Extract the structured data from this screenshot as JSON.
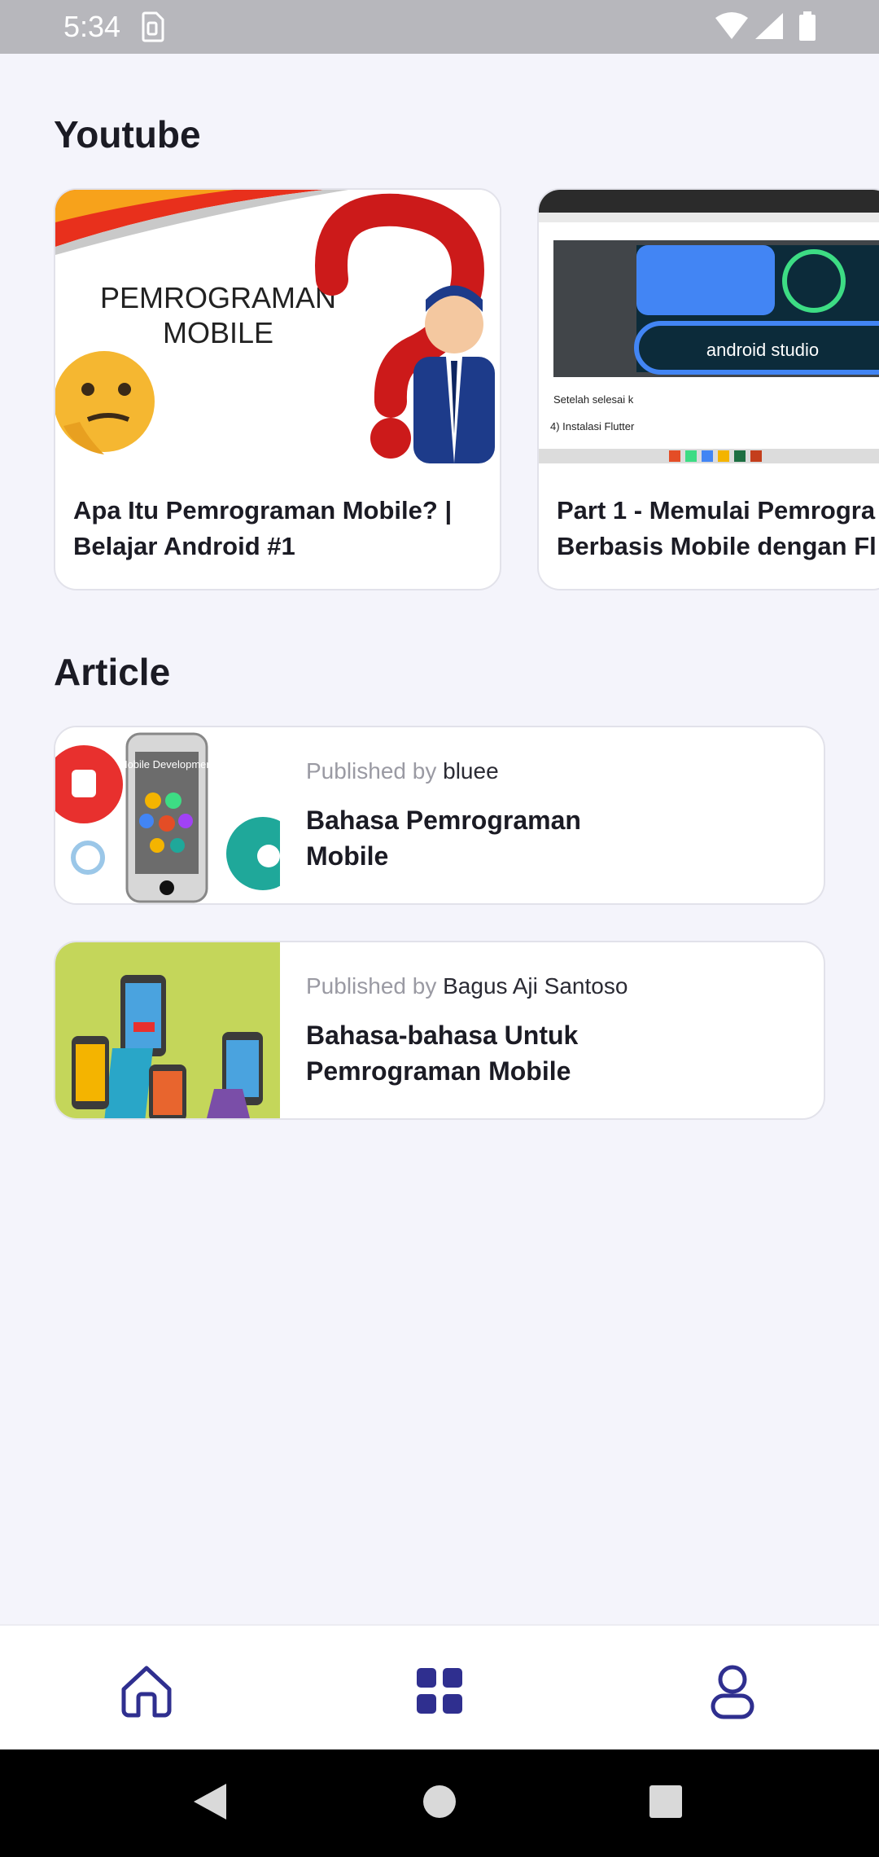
{
  "status_bar": {
    "time": "5:34"
  },
  "sections": {
    "youtube_title": "Youtube",
    "article_title": "Article"
  },
  "youtube": [
    {
      "title": "Apa Itu Pemrograman Mobile? | Belajar Android #1",
      "thumb_text_line1": "PEMROGRAMAN",
      "thumb_text_line2": "MOBILE"
    },
    {
      "title": "Part 1 - Memulai Pemrogra\nBerbasis Mobile dengan Fl",
      "thumb_text_brand": "android studio",
      "thumb_text_caption1": "Setelah selesai k",
      "thumb_text_caption2": "4)  Instalasi Flutter"
    }
  ],
  "articles": [
    {
      "published_by_label": "Published by",
      "author": "bluee",
      "title": "Bahasa Pemrograman Mobile",
      "thumb_text": "Mobile Development"
    },
    {
      "published_by_label": "Published by",
      "author": "Bagus Aji Santoso",
      "title": "Bahasa-bahasa Untuk Pemrograman Mobile"
    }
  ],
  "colors": {
    "accent": "#2f2f8f",
    "background": "#f4f4fb"
  },
  "bottom_nav": [
    {
      "icon": "home-icon"
    },
    {
      "icon": "grid-icon"
    },
    {
      "icon": "profile-icon"
    }
  ]
}
